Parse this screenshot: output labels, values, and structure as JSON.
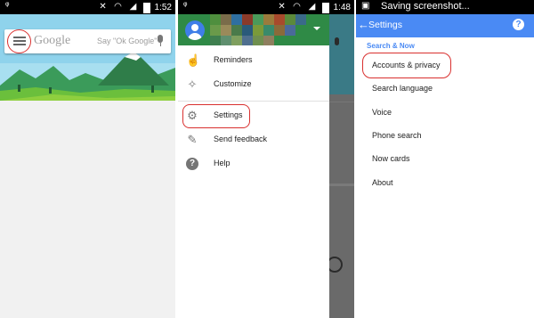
{
  "left_phone": {
    "status": {
      "time": "1:52"
    },
    "search": {
      "logo_text": "Google",
      "hint": "Say \"Ok Google\""
    }
  },
  "middle_phone": {
    "status": {
      "time": "1:48"
    },
    "drawer_items": [
      {
        "label": "Reminders",
        "icon": "reminders-icon"
      },
      {
        "label": "Customize",
        "icon": "magic-wand-icon"
      },
      {
        "label": "Settings",
        "icon": "gear-icon"
      },
      {
        "label": "Send feedback",
        "icon": "pencil-icon"
      },
      {
        "label": "Help",
        "icon": "help-icon"
      }
    ]
  },
  "right_phone": {
    "status": {
      "notice": "Saving screenshot..."
    },
    "appbar": {
      "title": "Settings"
    },
    "section_header": "Search & Now",
    "items": [
      "Accounts & privacy",
      "Search language",
      "Voice",
      "Phone search",
      "Now cards",
      "About"
    ]
  },
  "colors": {
    "highlight": "#d9302f",
    "accent_blue": "#4a8af4",
    "status_bar": "#000000",
    "drawer_header_green": "#2f8a46"
  }
}
